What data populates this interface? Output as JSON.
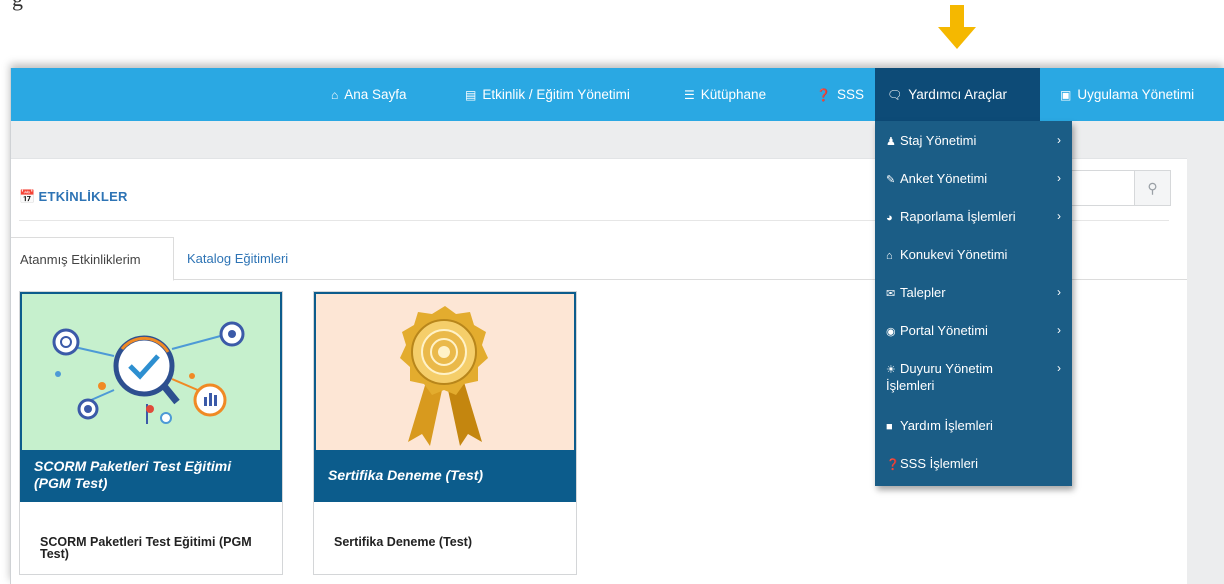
{
  "nav": {
    "items": [
      {
        "label": "Ana Sayfa",
        "icon": "home-icon"
      },
      {
        "label": "Etkinlik / Eğitim Yönetimi",
        "icon": "briefcase-icon"
      },
      {
        "label": "Kütüphane",
        "icon": "list-icon"
      },
      {
        "label": "SSS",
        "icon": "question-circle-icon"
      },
      {
        "label": "Yardımcı Araçlar",
        "icon": "comment-icon",
        "active": true
      },
      {
        "label": "Uygulama Yönetimi",
        "icon": "archive-icon"
      }
    ],
    "colors": {
      "bar": "#2aa8e3",
      "active": "#0d4b77"
    }
  },
  "page": {
    "title": "ETKİNLİKLER",
    "title_icon": "calendar-icon",
    "search_icon": "search-icon"
  },
  "tabs": [
    {
      "label": "Atanmış Etkinliklerim",
      "active": true
    },
    {
      "label": "Katalog Eğitimleri",
      "active": false
    }
  ],
  "cards": [
    {
      "banner": "SCORM Paketleri Test Eğitimi (PGM Test)",
      "name": "SCORM Paketleri Test Eğitimi (PGM Test)",
      "image": "analytics-illustration"
    },
    {
      "banner": "Sertifika Deneme (Test)",
      "name": "Sertifika Deneme (Test)",
      "image": "certificate-seal-illustration"
    }
  ],
  "dropdown": {
    "items": [
      {
        "label": "Staj Yönetimi",
        "icon": "user-icon",
        "submenu": true
      },
      {
        "label": "Anket Yönetimi",
        "icon": "edit-icon",
        "submenu": true
      },
      {
        "label": "Raporlama İşlemleri",
        "icon": "pie-chart-icon",
        "submenu": true
      },
      {
        "label": "Konukevi Yönetimi",
        "icon": "home-icon",
        "submenu": false
      },
      {
        "label": "Talepler",
        "icon": "comments-icon",
        "submenu": true
      },
      {
        "label": "Portal Yönetimi",
        "icon": "bullseye-icon",
        "submenu": true
      },
      {
        "label": "Duyuru Yönetim İşlemleri",
        "icon": "bullhorn-icon",
        "submenu": true
      },
      {
        "label": "Yardım İşlemleri",
        "icon": "pencil-square-icon",
        "submenu": false
      },
      {
        "label": "SSS İşlemleri",
        "icon": "question-circle-icon",
        "submenu": false
      }
    ],
    "color": "#1b5d86"
  },
  "annotation": {
    "arrow_icon": "down-arrow-icon",
    "arrow_color": "#f5b800"
  }
}
